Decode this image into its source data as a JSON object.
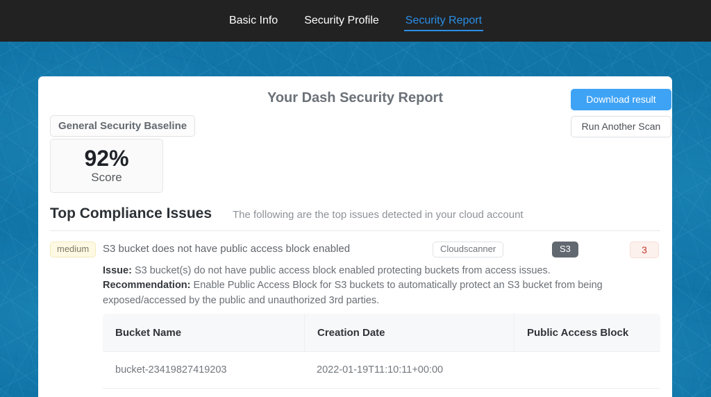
{
  "navbar": {
    "tabs": [
      {
        "label": "Basic Info",
        "active": false
      },
      {
        "label": "Security Profile",
        "active": false
      },
      {
        "label": "Security Report",
        "active": true
      }
    ],
    "background_color": "#222222",
    "active_color": "#2b8fe8"
  },
  "report": {
    "title": "Your Dash Security Report",
    "download_button": "Download result",
    "rescan_button": "Run Another Scan",
    "baseline_label": "General Security Baseline",
    "score_value": "92%",
    "score_label": "Score",
    "primary_color": "#3fa3f5"
  },
  "section": {
    "title": "Top Compliance Issues",
    "subtitle": "The following are the top issues detected in your cloud account"
  },
  "issue": {
    "severity": "medium",
    "severity_color": "#fdf9e3",
    "title": "S3 bucket does not have public access block enabled",
    "scanner_badge": "Cloudscanner",
    "service_badge": "S3",
    "count_badge": "3",
    "count_color": "#c0392b",
    "issue_label": "Issue:",
    "issue_text": "S3 bucket(s) do not have public access block enabled protecting buckets from access issues.",
    "recommendation_label": "Recommendation:",
    "recommendation_text": "Enable Public Access Block for S3 buckets to automatically protect an S3 bucket from being exposed/accessed by the public and unauthorized 3rd parties."
  },
  "table": {
    "columns": [
      "Bucket Name",
      "Creation Date",
      "Public Access Block"
    ],
    "rows": [
      {
        "bucket_name": "bucket-23419827419203",
        "creation_date": "2022-01-19T11:10:11+00:00",
        "public_access_block": ""
      }
    ]
  }
}
